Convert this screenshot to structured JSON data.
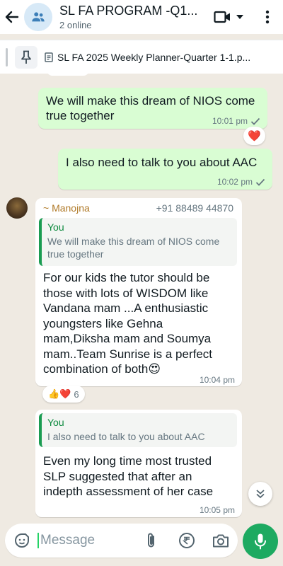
{
  "header": {
    "title": "SL FA PROGRAM -Q1...",
    "subtitle": "2 online"
  },
  "pinned": {
    "text": "SL FA 2025 Weekly Planner-Quarter 1-1.p..."
  },
  "messages": [
    {
      "text": "We will make this dream of NIOS come true together",
      "time": "10:01 pm",
      "reaction": "❤️"
    },
    {
      "text": "I also need to talk to you about AAC",
      "time": "10:02 pm"
    },
    {
      "sender": "~ Manojna",
      "phone": "+91 88489 44870",
      "quote_name": "You",
      "quote_text": "We will make this dream of NIOS come true together",
      "text_lines": [
        "For our kids the tutor should  be",
        "those with lots of WISDOM like",
        "Vandana mam ...A enthusiastic",
        "youngsters like Gehna",
        "mam,Diksha mam and Soumya",
        "mam..Team Sunrise is a perfect",
        "combination of both😍"
      ],
      "time": "10:04 pm",
      "reactions": "👍❤️",
      "reaction_count": "6"
    },
    {
      "quote_name": "You",
      "quote_text": "I also need to talk to you about AAC",
      "text_lines": [
        "Even my long time most trusted",
        "SLP suggested that after an",
        "indepth assessment of her case"
      ],
      "time": "10:05 pm"
    }
  ],
  "composer": {
    "placeholder": "Message"
  },
  "colors": {
    "outgoing": "#d9fdd3",
    "incoming": "#ffffff",
    "accent": "#1daa61",
    "background": "#efeae2"
  }
}
